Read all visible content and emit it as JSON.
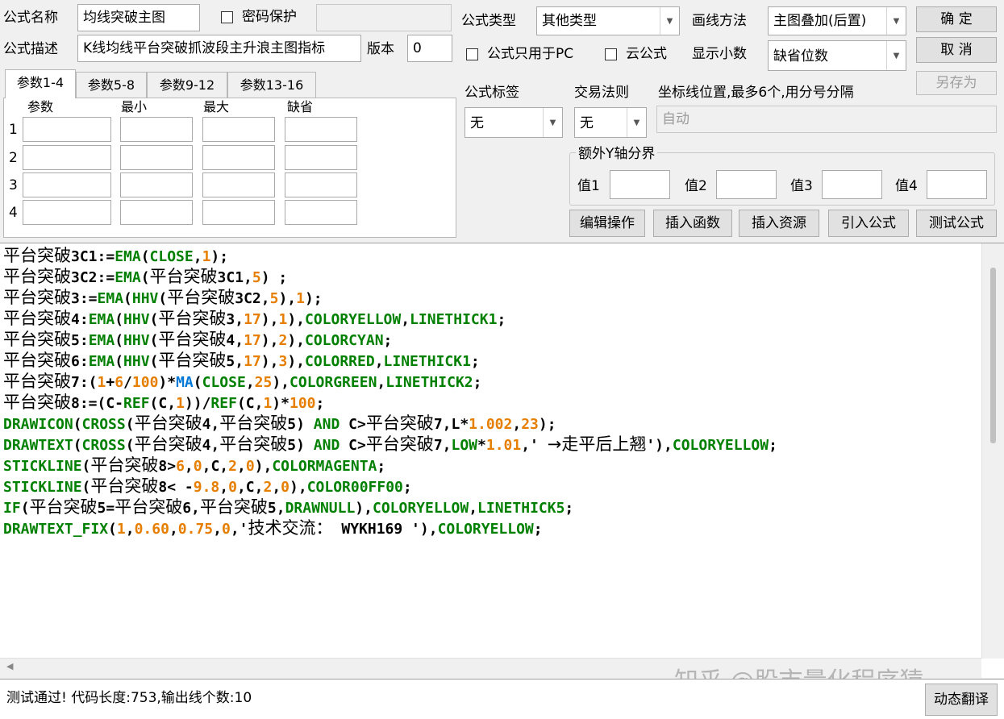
{
  "header": {
    "name_label": "公式名称",
    "name_value": "均线突破主图",
    "password_label": "密码保护",
    "desc_label": "公式描述",
    "desc_value": "K线均线平台突破抓波段主升浪主图指标",
    "version_label": "版本",
    "version_value": "0",
    "type_label": "公式类型",
    "type_value": "其他类型",
    "draw_label": "画线方法",
    "draw_value": "主图叠加(后置)",
    "pc_only_label": "公式只用于PC",
    "cloud_label": "云公式",
    "decimals_label": "显示小数",
    "decimals_value": "缺省位数",
    "tag_label": "公式标签",
    "tag_value": "无",
    "trade_label": "交易法则",
    "trade_value": "无",
    "axis_label": "坐标线位置,最多6个,用分号分隔",
    "axis_value": "自动",
    "yaxis_group_label": "额外Y轴分界",
    "y_values": [
      "值1",
      "值2",
      "值3",
      "值4"
    ]
  },
  "buttons": {
    "ok": "确  定",
    "cancel": "取  消",
    "save_as": "另存为",
    "edit_ops": "编辑操作",
    "insert_fn": "插入函数",
    "insert_res": "插入资源",
    "import_formula": "引入公式",
    "test_formula": "测试公式",
    "translate": "动态翻译"
  },
  "tabs": [
    "参数1-4",
    "参数5-8",
    "参数9-12",
    "参数13-16"
  ],
  "param_table": {
    "headers": [
      "参数",
      "最小",
      "最大",
      "缺省"
    ],
    "rows": [
      "1",
      "2",
      "3",
      "4"
    ]
  },
  "code": [
    [
      [
        "平台突破",
        "cn"
      ],
      [
        "3C1:=",
        "plain"
      ],
      [
        "EMA",
        "fn"
      ],
      [
        "(",
        "plain"
      ],
      [
        "CLOSE",
        "fn"
      ],
      [
        ",",
        "plain"
      ],
      [
        "1",
        "num"
      ],
      [
        ");",
        "plain"
      ]
    ],
    [
      [
        "平台突破",
        "cn"
      ],
      [
        "3C2:=",
        "plain"
      ],
      [
        "EMA",
        "fn"
      ],
      [
        "(",
        "plain"
      ],
      [
        "平台突破",
        "cn"
      ],
      [
        "3C1,",
        "plain"
      ],
      [
        "5",
        "num"
      ],
      [
        ") ;",
        "plain"
      ]
    ],
    [
      [
        "平台突破",
        "cn"
      ],
      [
        "3:=",
        "plain"
      ],
      [
        "EMA",
        "fn"
      ],
      [
        "(",
        "plain"
      ],
      [
        "HHV",
        "fn"
      ],
      [
        "(",
        "plain"
      ],
      [
        "平台突破",
        "cn"
      ],
      [
        "3C2,",
        "plain"
      ],
      [
        "5",
        "num"
      ],
      [
        "),",
        "plain"
      ],
      [
        "1",
        "num"
      ],
      [
        ");",
        "plain"
      ]
    ],
    [
      [
        "平台突破",
        "cn"
      ],
      [
        "4:",
        "plain"
      ],
      [
        "EMA",
        "fn"
      ],
      [
        "(",
        "plain"
      ],
      [
        "HHV",
        "fn"
      ],
      [
        "(",
        "plain"
      ],
      [
        "平台突破",
        "cn"
      ],
      [
        "3,",
        "plain"
      ],
      [
        "17",
        "num"
      ],
      [
        "),",
        "plain"
      ],
      [
        "1",
        "num"
      ],
      [
        "),",
        "plain"
      ],
      [
        "COLORYELLOW",
        "fn"
      ],
      [
        ",",
        "plain"
      ],
      [
        "LINETHICK1",
        "fn"
      ],
      [
        ";",
        "plain"
      ]
    ],
    [
      [
        "平台突破",
        "cn"
      ],
      [
        "5:",
        "plain"
      ],
      [
        "EMA",
        "fn"
      ],
      [
        "(",
        "plain"
      ],
      [
        "HHV",
        "fn"
      ],
      [
        "(",
        "plain"
      ],
      [
        "平台突破",
        "cn"
      ],
      [
        "4,",
        "plain"
      ],
      [
        "17",
        "num"
      ],
      [
        "),",
        "plain"
      ],
      [
        "2",
        "num"
      ],
      [
        "),",
        "plain"
      ],
      [
        "COLORCYAN",
        "fn"
      ],
      [
        ";",
        "plain"
      ]
    ],
    [
      [
        "平台突破",
        "cn"
      ],
      [
        "6:",
        "plain"
      ],
      [
        "EMA",
        "fn"
      ],
      [
        "(",
        "plain"
      ],
      [
        "HHV",
        "fn"
      ],
      [
        "(",
        "plain"
      ],
      [
        "平台突破",
        "cn"
      ],
      [
        "5,",
        "plain"
      ],
      [
        "17",
        "num"
      ],
      [
        "),",
        "plain"
      ],
      [
        "3",
        "num"
      ],
      [
        "),",
        "plain"
      ],
      [
        "COLORRED",
        "fn"
      ],
      [
        ",",
        "plain"
      ],
      [
        "LINETHICK1",
        "fn"
      ],
      [
        ";",
        "plain"
      ]
    ],
    [
      [
        "平台突破",
        "cn"
      ],
      [
        "7:(",
        "plain"
      ],
      [
        "1",
        "num"
      ],
      [
        "+",
        "plain"
      ],
      [
        "6",
        "num"
      ],
      [
        "/",
        "plain"
      ],
      [
        "100",
        "num"
      ],
      [
        ")*",
        "plain"
      ],
      [
        "MA",
        "blue"
      ],
      [
        "(",
        "plain"
      ],
      [
        "CLOSE",
        "fn"
      ],
      [
        ",",
        "plain"
      ],
      [
        "25",
        "num"
      ],
      [
        "),",
        "plain"
      ],
      [
        "COLORGREEN",
        "fn"
      ],
      [
        ",",
        "plain"
      ],
      [
        "LINETHICK2",
        "fn"
      ],
      [
        ";",
        "plain"
      ]
    ],
    [
      [
        "平台突破",
        "cn"
      ],
      [
        "8:=(C-",
        "plain"
      ],
      [
        "REF",
        "fn"
      ],
      [
        "(C,",
        "plain"
      ],
      [
        "1",
        "num"
      ],
      [
        "))/",
        "plain"
      ],
      [
        "REF",
        "fn"
      ],
      [
        "(C,",
        "plain"
      ],
      [
        "1",
        "num"
      ],
      [
        ")*",
        "plain"
      ],
      [
        "100",
        "num"
      ],
      [
        ";",
        "plain"
      ]
    ],
    [
      [
        "DRAWICON",
        "fn"
      ],
      [
        "(",
        "plain"
      ],
      [
        "CROSS",
        "fn"
      ],
      [
        "(",
        "plain"
      ],
      [
        "平台突破",
        "cn"
      ],
      [
        "4,",
        "plain"
      ],
      [
        "平台突破",
        "cn"
      ],
      [
        "5) ",
        "plain"
      ],
      [
        "AND",
        "fn"
      ],
      [
        " C>",
        "plain"
      ],
      [
        "平台突破",
        "cn"
      ],
      [
        "7,L*",
        "plain"
      ],
      [
        "1.002",
        "num"
      ],
      [
        ",",
        "plain"
      ],
      [
        "23",
        "num"
      ],
      [
        ");",
        "plain"
      ]
    ],
    [
      [
        "DRAWTEXT",
        "fn"
      ],
      [
        "(",
        "plain"
      ],
      [
        "CROSS",
        "fn"
      ],
      [
        "(",
        "plain"
      ],
      [
        "平台突破",
        "cn"
      ],
      [
        "4,",
        "plain"
      ],
      [
        "平台突破",
        "cn"
      ],
      [
        "5) ",
        "plain"
      ],
      [
        "AND",
        "fn"
      ],
      [
        " C>",
        "plain"
      ],
      [
        "平台突破",
        "cn"
      ],
      [
        "7,",
        "plain"
      ],
      [
        "LOW",
        "fn"
      ],
      [
        "*",
        "plain"
      ],
      [
        "1.01",
        "num"
      ],
      [
        ",' ",
        "plain"
      ],
      [
        "→走平后上翘",
        "cn"
      ],
      [
        "'),",
        "plain"
      ],
      [
        "COLORYELLOW",
        "fn"
      ],
      [
        ";",
        "plain"
      ]
    ],
    [
      [
        "STICKLINE",
        "fn"
      ],
      [
        "(",
        "plain"
      ],
      [
        "平台突破",
        "cn"
      ],
      [
        "8>",
        "plain"
      ],
      [
        "6",
        "num"
      ],
      [
        ",",
        "plain"
      ],
      [
        "0",
        "num"
      ],
      [
        ",C,",
        "plain"
      ],
      [
        "2",
        "num"
      ],
      [
        ",",
        "plain"
      ],
      [
        "0",
        "num"
      ],
      [
        "),",
        "plain"
      ],
      [
        "COLORMAGENTA",
        "fn"
      ],
      [
        ";",
        "plain"
      ]
    ],
    [
      [
        "STICKLINE",
        "fn"
      ],
      [
        "(",
        "plain"
      ],
      [
        "平台突破",
        "cn"
      ],
      [
        "8< -",
        "plain"
      ],
      [
        "9.8",
        "num"
      ],
      [
        ",",
        "plain"
      ],
      [
        "0",
        "num"
      ],
      [
        ",C,",
        "plain"
      ],
      [
        "2",
        "num"
      ],
      [
        ",",
        "plain"
      ],
      [
        "0",
        "num"
      ],
      [
        "),",
        "plain"
      ],
      [
        "COLOR00FF00",
        "fn"
      ],
      [
        ";",
        "plain"
      ]
    ],
    [
      [
        "IF",
        "fn"
      ],
      [
        "(",
        "plain"
      ],
      [
        "平台突破",
        "cn"
      ],
      [
        "5=",
        "plain"
      ],
      [
        "平台突破",
        "cn"
      ],
      [
        "6,",
        "plain"
      ],
      [
        "平台突破",
        "cn"
      ],
      [
        "5,",
        "plain"
      ],
      [
        "DRAWNULL",
        "fn"
      ],
      [
        "),",
        "plain"
      ],
      [
        "COLORYELLOW",
        "fn"
      ],
      [
        ",",
        "plain"
      ],
      [
        "LINETHICK5",
        "fn"
      ],
      [
        ";",
        "plain"
      ]
    ],
    [
      [
        "DRAWTEXT_FIX",
        "fn"
      ],
      [
        "(",
        "plain"
      ],
      [
        "1",
        "num"
      ],
      [
        ",",
        "plain"
      ],
      [
        "0.60",
        "num"
      ],
      [
        ",",
        "plain"
      ],
      [
        "0.75",
        "num"
      ],
      [
        ",",
        "plain"
      ],
      [
        "0",
        "num"
      ],
      [
        ",'",
        "plain"
      ],
      [
        "技术交流：",
        "cn"
      ],
      [
        " WYKH169 '),",
        "plain"
      ],
      [
        "COLORYELLOW",
        "fn"
      ],
      [
        ";",
        "plain"
      ]
    ]
  ],
  "status": {
    "message": "测试通过! 代码长度:753,输出线个数:10"
  },
  "watermark": "知乎 @股市量化程序猿",
  "colors": {
    "keyword": "#008000",
    "number": "#e67e00",
    "ma": "#0078d7",
    "background": "#f0f0f0"
  }
}
